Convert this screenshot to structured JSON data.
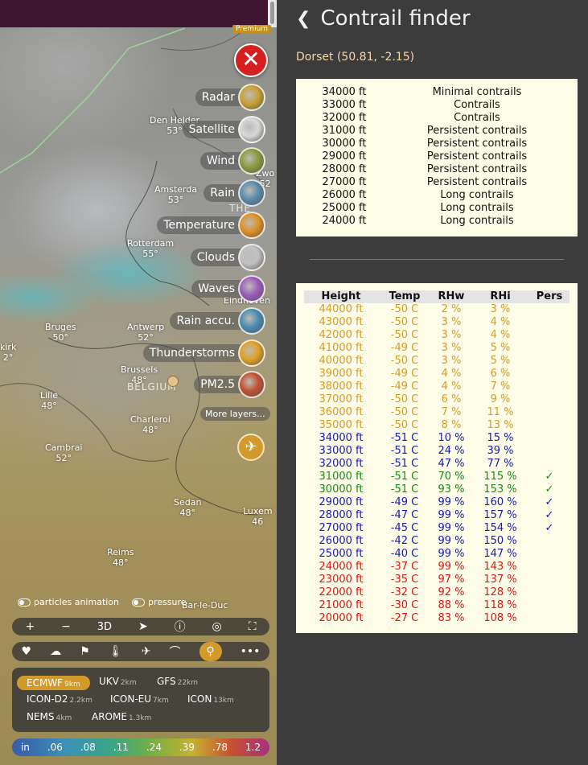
{
  "map": {
    "premium_badge": "Premium",
    "places": [
      {
        "name": "Den Helder",
        "value": "53°",
        "pos": "dh"
      },
      {
        "name": "Amsterda",
        "value": "53°",
        "pos": "am"
      },
      {
        "name": "Rotterdam",
        "value": "55°",
        "pos": "ro"
      },
      {
        "name": "Eindhoven",
        "value": "",
        "pos": "ei"
      },
      {
        "name": "Antwerp",
        "value": "52°",
        "pos": "an"
      },
      {
        "name": "Bruges",
        "value": "50°",
        "pos": "br"
      },
      {
        "name": "Brussels",
        "value": "48°",
        "pos": "bx"
      },
      {
        "name": "Lille",
        "value": "48°",
        "pos": "li"
      },
      {
        "name": "Charleroi",
        "value": "48°",
        "pos": "ch"
      },
      {
        "name": "Cambrai",
        "value": "52°",
        "pos": "ca"
      },
      {
        "name": "Sedan",
        "value": "48°",
        "pos": "se"
      },
      {
        "name": "Reims",
        "value": "48°",
        "pos": "re"
      },
      {
        "name": "Bar-le-Duc",
        "value": "",
        "pos": "bd"
      },
      {
        "name": "Luxem",
        "value": "46",
        "pos": "lu"
      },
      {
        "name": "kirk",
        "value": "2°",
        "pos": "ki"
      },
      {
        "name": "Zwo",
        "value": "52",
        "pos": "zw"
      }
    ],
    "countries": {
      "belgium": "BELGIUM",
      "netherlands": "THE"
    },
    "layers": [
      {
        "name": "Radar",
        "color": "#c8a030"
      },
      {
        "name": "Satellite",
        "color": "#d8d8d8"
      },
      {
        "name": "Wind",
        "color": "#8a9a3a"
      },
      {
        "name": "Rain",
        "color": "#5a8aa8"
      },
      {
        "name": "Temperature",
        "color": "#e09020"
      },
      {
        "name": "Clouds",
        "color": "#c0c0c0"
      },
      {
        "name": "Waves",
        "color": "#9a5ab8"
      },
      {
        "name": "Rain accu.",
        "color": "#4a8ab0"
      },
      {
        "name": "Thunderstorms",
        "color": "#e0a020"
      },
      {
        "name": "PM2.5",
        "color": "#c05030"
      }
    ],
    "more_layers": "More layers...",
    "toggles": {
      "particles": "particles animation",
      "pressure": "pressure"
    },
    "toolbar": [
      "+",
      "−",
      "3D",
      "➤",
      "ⓘ",
      "◎",
      "⛶"
    ],
    "models": [
      {
        "name": "ECMWF",
        "res": "9km",
        "selected": true
      },
      {
        "name": "UKV",
        "res": "2km",
        "selected": false
      },
      {
        "name": "GFS",
        "res": "22km",
        "selected": false
      },
      {
        "name": "ICON-D2",
        "res": "2.2km",
        "selected": false
      },
      {
        "name": "ICON-EU",
        "res": "7km",
        "selected": false
      },
      {
        "name": "ICON",
        "res": "13km",
        "selected": false
      },
      {
        "name": "NEMS",
        "res": "4km",
        "selected": false
      },
      {
        "name": "AROME",
        "res": "1.3km",
        "selected": false
      }
    ],
    "scale": [
      "in",
      ".06",
      ".08",
      ".11",
      ".24",
      ".39",
      ".78",
      "1.2"
    ]
  },
  "panel": {
    "title": "Contrail finder",
    "location": "Dorset (50.81, -2.15)",
    "summary": [
      {
        "height": "34000 ft",
        "status": "Minimal contrails"
      },
      {
        "height": "33000 ft",
        "status": "Contrails"
      },
      {
        "height": "32000 ft",
        "status": "Contrails"
      },
      {
        "height": "31000 ft",
        "status": "Persistent contrails"
      },
      {
        "height": "30000 ft",
        "status": "Persistent contrails"
      },
      {
        "height": "29000 ft",
        "status": "Persistent contrails"
      },
      {
        "height": "28000 ft",
        "status": "Persistent contrails"
      },
      {
        "height": "27000 ft",
        "status": "Persistent contrails"
      },
      {
        "height": "26000 ft",
        "status": "Long contrails"
      },
      {
        "height": "25000 ft",
        "status": "Long contrails"
      },
      {
        "height": "24000 ft",
        "status": "Long contrails"
      }
    ],
    "table_headers": {
      "height": "Height",
      "temp": "Temp",
      "rhw": "RHw",
      "rhi": "RHi",
      "pers": "Pers"
    },
    "colors": {
      "orange": "#d89a28",
      "blue": "#1a1ab0",
      "green": "#1a8a1a",
      "red": "#d81818"
    },
    "rows": [
      {
        "height": "44000 ft",
        "temp": "-50 C",
        "rhw": "2 %",
        "rhi": "3 %",
        "pers": "",
        "color": "orange"
      },
      {
        "height": "43000 ft",
        "temp": "-50 C",
        "rhw": "3 %",
        "rhi": "4 %",
        "pers": "",
        "color": "orange"
      },
      {
        "height": "42000 ft",
        "temp": "-50 C",
        "rhw": "3 %",
        "rhi": "4 %",
        "pers": "",
        "color": "orange"
      },
      {
        "height": "41000 ft",
        "temp": "-49 C",
        "rhw": "3 %",
        "rhi": "5 %",
        "pers": "",
        "color": "orange"
      },
      {
        "height": "40000 ft",
        "temp": "-50 C",
        "rhw": "3 %",
        "rhi": "5 %",
        "pers": "",
        "color": "orange"
      },
      {
        "height": "39000 ft",
        "temp": "-49 C",
        "rhw": "4 %",
        "rhi": "6 %",
        "pers": "",
        "color": "orange"
      },
      {
        "height": "38000 ft",
        "temp": "-49 C",
        "rhw": "4 %",
        "rhi": "7 %",
        "pers": "",
        "color": "orange"
      },
      {
        "height": "37000 ft",
        "temp": "-50 C",
        "rhw": "6 %",
        "rhi": "9 %",
        "pers": "",
        "color": "orange"
      },
      {
        "height": "36000 ft",
        "temp": "-50 C",
        "rhw": "7 %",
        "rhi": "11 %",
        "pers": "",
        "color": "orange"
      },
      {
        "height": "35000 ft",
        "temp": "-50 C",
        "rhw": "8 %",
        "rhi": "13 %",
        "pers": "",
        "color": "orange"
      },
      {
        "height": "34000 ft",
        "temp": "-51 C",
        "rhw": "10 %",
        "rhi": "15 %",
        "pers": "",
        "color": "blue"
      },
      {
        "height": "33000 ft",
        "temp": "-51 C",
        "rhw": "24 %",
        "rhi": "39 %",
        "pers": "",
        "color": "blue"
      },
      {
        "height": "32000 ft",
        "temp": "-51 C",
        "rhw": "47 %",
        "rhi": "77 %",
        "pers": "",
        "color": "blue"
      },
      {
        "height": "31000 ft",
        "temp": "-51 C",
        "rhw": "70 %",
        "rhi": "115 %",
        "pers": "✓",
        "color": "green"
      },
      {
        "height": "30000 ft",
        "temp": "-51 C",
        "rhw": "93 %",
        "rhi": "153 %",
        "pers": "✓",
        "color": "green"
      },
      {
        "height": "29000 ft",
        "temp": "-49 C",
        "rhw": "99 %",
        "rhi": "160 %",
        "pers": "✓",
        "color": "blue"
      },
      {
        "height": "28000 ft",
        "temp": "-47 C",
        "rhw": "99 %",
        "rhi": "157 %",
        "pers": "✓",
        "color": "blue"
      },
      {
        "height": "27000 ft",
        "temp": "-45 C",
        "rhw": "99 %",
        "rhi": "154 %",
        "pers": "✓",
        "color": "blue"
      },
      {
        "height": "26000 ft",
        "temp": "-42 C",
        "rhw": "99 %",
        "rhi": "150 %",
        "pers": "",
        "color": "blue"
      },
      {
        "height": "25000 ft",
        "temp": "-40 C",
        "rhw": "99 %",
        "rhi": "147 %",
        "pers": "",
        "color": "blue"
      },
      {
        "height": "24000 ft",
        "temp": "-37 C",
        "rhw": "99 %",
        "rhi": "143 %",
        "pers": "",
        "color": "red"
      },
      {
        "height": "23000 ft",
        "temp": "-35 C",
        "rhw": "97 %",
        "rhi": "137 %",
        "pers": "",
        "color": "red"
      },
      {
        "height": "22000 ft",
        "temp": "-32 C",
        "rhw": "92 %",
        "rhi": "128 %",
        "pers": "",
        "color": "red"
      },
      {
        "height": "21000 ft",
        "temp": "-30 C",
        "rhw": "88 %",
        "rhi": "118 %",
        "pers": "",
        "color": "red"
      },
      {
        "height": "20000 ft",
        "temp": "-27 C",
        "rhw": "83 %",
        "rhi": "108 %",
        "pers": "",
        "color": "red"
      }
    ]
  }
}
